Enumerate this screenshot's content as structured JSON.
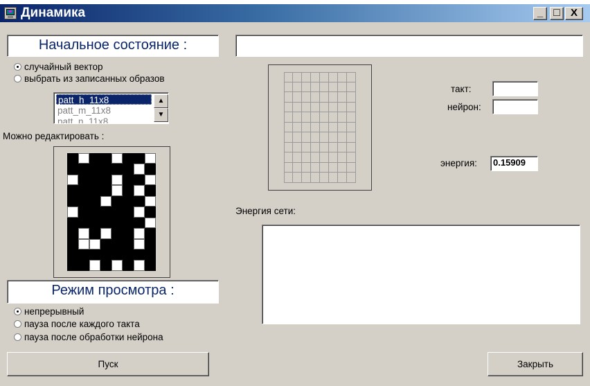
{
  "window": {
    "title": "Динамика"
  },
  "titlebar_buttons": {
    "minimize": "_",
    "maximize": "□",
    "close": "X"
  },
  "initial_state": {
    "heading": "Начальное состояние :",
    "options": [
      {
        "label": "случайный вектор",
        "selected": true
      },
      {
        "label": "выбрать из записанных образов",
        "selected": false
      }
    ]
  },
  "patterns_list": {
    "items": [
      {
        "label": "patt_h_11x8",
        "selected": true
      },
      {
        "label": "patt_m_11x8",
        "selected": false
      },
      {
        "label": "patt_n_11x8",
        "selected": false
      }
    ]
  },
  "editable_label": "Можно редактировать :",
  "pattern_grid": {
    "rows": 11,
    "cols": 8,
    "cells": [
      [
        1,
        0,
        1,
        1,
        0,
        1,
        1,
        0
      ],
      [
        1,
        1,
        1,
        1,
        1,
        1,
        0,
        1
      ],
      [
        0,
        1,
        1,
        1,
        0,
        1,
        1,
        0
      ],
      [
        1,
        1,
        1,
        1,
        0,
        1,
        0,
        1
      ],
      [
        1,
        1,
        1,
        0,
        1,
        1,
        1,
        0
      ],
      [
        0,
        1,
        1,
        1,
        1,
        1,
        0,
        1
      ],
      [
        1,
        1,
        1,
        1,
        1,
        1,
        1,
        0
      ],
      [
        1,
        0,
        1,
        0,
        1,
        1,
        0,
        1
      ],
      [
        1,
        0,
        0,
        1,
        1,
        1,
        0,
        1
      ],
      [
        1,
        1,
        1,
        1,
        1,
        1,
        1,
        1
      ],
      [
        1,
        1,
        0,
        1,
        0,
        1,
        0,
        1
      ]
    ]
  },
  "view_mode": {
    "heading": "Режим просмотра :",
    "options": [
      {
        "label": "непрерывный",
        "selected": true
      },
      {
        "label": "пауза после каждого такта",
        "selected": false
      },
      {
        "label": "пауза после обработки нейрона",
        "selected": false
      }
    ]
  },
  "buttons": {
    "start": "Пуск",
    "close": "Закрыть"
  },
  "status": {
    "tact_label": "такт:",
    "tact_value": "",
    "neuron_label": "нейрон:",
    "neuron_value": "",
    "energy_label": "энергия:",
    "energy_value": "0.15909"
  },
  "energy_chart_label": "Энергия сети:",
  "network_grid": {
    "rows": 11,
    "cols": 8
  }
}
